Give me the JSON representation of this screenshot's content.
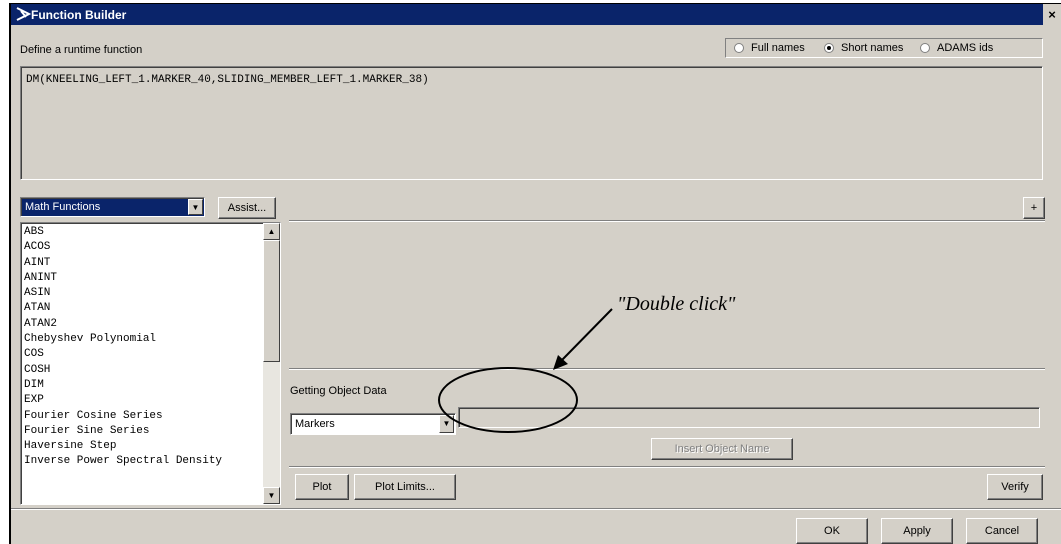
{
  "window": {
    "title": "Function Builder",
    "close_glyph": "×"
  },
  "header": {
    "label": "Define a runtime function"
  },
  "name_mode": {
    "options": [
      {
        "label": "Full names",
        "selected": false
      },
      {
        "label": "Short names",
        "selected": true
      },
      {
        "label": "ADAMS ids",
        "selected": false
      }
    ]
  },
  "function_text": "DM(KNEELING_LEFT_1.MARKER_40,SLIDING_MEMBER_LEFT_1.MARKER_38)",
  "category": {
    "selected": "Math Functions",
    "assist_label": "Assist..."
  },
  "expand_label": "+",
  "functions": [
    "ABS",
    "ACOS",
    "AINT",
    "ANINT",
    "ASIN",
    "ATAN",
    "ATAN2",
    "Chebyshev Polynomial",
    "COS",
    "COSH",
    "DIM",
    "EXP",
    "Fourier Cosine Series",
    "Fourier Sine Series",
    "Haversine Step",
    "Inverse Power Spectral Density"
  ],
  "object_data": {
    "label": "Getting Object Data",
    "type_selected": "Markers",
    "field_value": "",
    "insert_label": "Insert Object Name"
  },
  "annotation": "\"Double click\"",
  "bottom_toolbar": {
    "plot": "Plot",
    "plot_limits": "Plot Limits...",
    "verify": "Verify"
  },
  "dialog_buttons": {
    "ok": "OK",
    "apply": "Apply",
    "cancel": "Cancel"
  },
  "icons": {
    "title": "adams-logo-icon",
    "dropdown": "chevron-down-icon",
    "scroll_up": "arrow-up-icon",
    "scroll_down": "arrow-down-icon"
  },
  "colors": {
    "titlebar": "#0a246a",
    "face": "#d4d0c8"
  }
}
